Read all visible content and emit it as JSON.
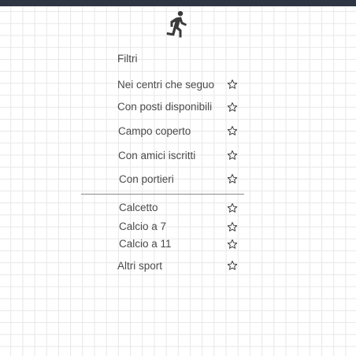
{
  "header": {
    "icon": "running-person-icon"
  },
  "filters": {
    "title": "Filtri",
    "items": [
      {
        "label": "Nei centri che seguo",
        "icon": "star-outline-icon"
      },
      {
        "label": "Con posti disponibili",
        "icon": "star-outline-icon"
      },
      {
        "label": "Campo coperto",
        "icon": "star-outline-icon"
      },
      {
        "label": "Con amici iscritti",
        "icon": "star-outline-icon"
      },
      {
        "label": "Con portieri",
        "icon": "star-outline-icon"
      }
    ]
  },
  "sports": {
    "items": [
      {
        "label": "Calcetto",
        "icon": "star-outline-icon"
      },
      {
        "label": "Calcio a 7",
        "icon": "star-outline-icon"
      },
      {
        "label": "Calcio a 11",
        "icon": "star-outline-icon"
      },
      {
        "label": "Altri sport",
        "icon": "star-outline-icon"
      }
    ]
  },
  "colors": {
    "topbar": "#2e3643",
    "text": "#4a4a4a",
    "icon": "#3a3a3a"
  }
}
